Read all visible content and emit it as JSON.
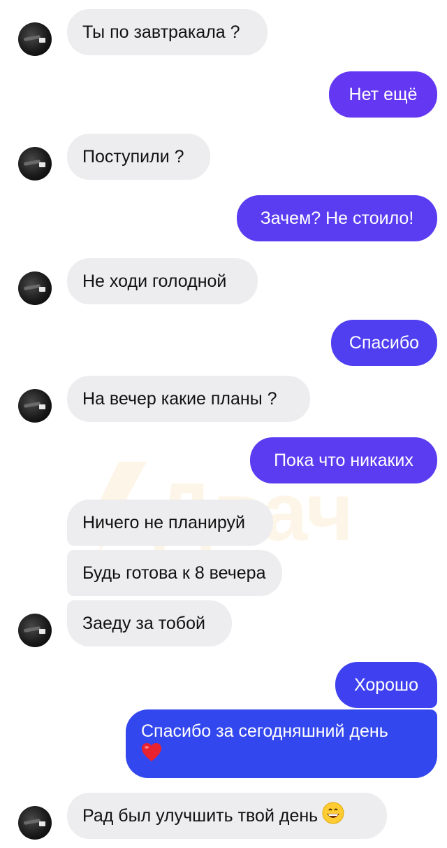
{
  "messages": [
    {
      "side": "in",
      "text": "Ты по завтракала ?"
    },
    {
      "side": "out",
      "text": "Нет ещё"
    },
    {
      "side": "in",
      "text": "Поступили ?"
    },
    {
      "side": "out",
      "text": "Зачем? Не стоило!"
    },
    {
      "side": "in",
      "text": "Не ходи голодной"
    },
    {
      "side": "out",
      "text": "Спасибо"
    },
    {
      "side": "in",
      "text": "На вечер какие планы ?"
    },
    {
      "side": "out",
      "text": "Пока что никаких"
    },
    {
      "side": "in",
      "text": "Ничего не планируй"
    },
    {
      "side": "in",
      "text": "Будь готова к 8 вечера"
    },
    {
      "side": "in",
      "text": "Заеду за тобой"
    },
    {
      "side": "out",
      "text": "Хорошо"
    },
    {
      "side": "out",
      "text": "Спасибо за сегодняшний день",
      "emoji": "red-heart"
    },
    {
      "side": "in",
      "text": "Рад был улучшить твой день",
      "emoji": "grinning-face"
    }
  ],
  "watermark": {
    "text": "Двач",
    "icon": "lightning-bolt-icon",
    "color": "#f5a623"
  },
  "colors": {
    "incoming_bg": "#ededef",
    "outgoing_top": "#6a3cf0",
    "outgoing_bottom": "#2f45ef"
  }
}
